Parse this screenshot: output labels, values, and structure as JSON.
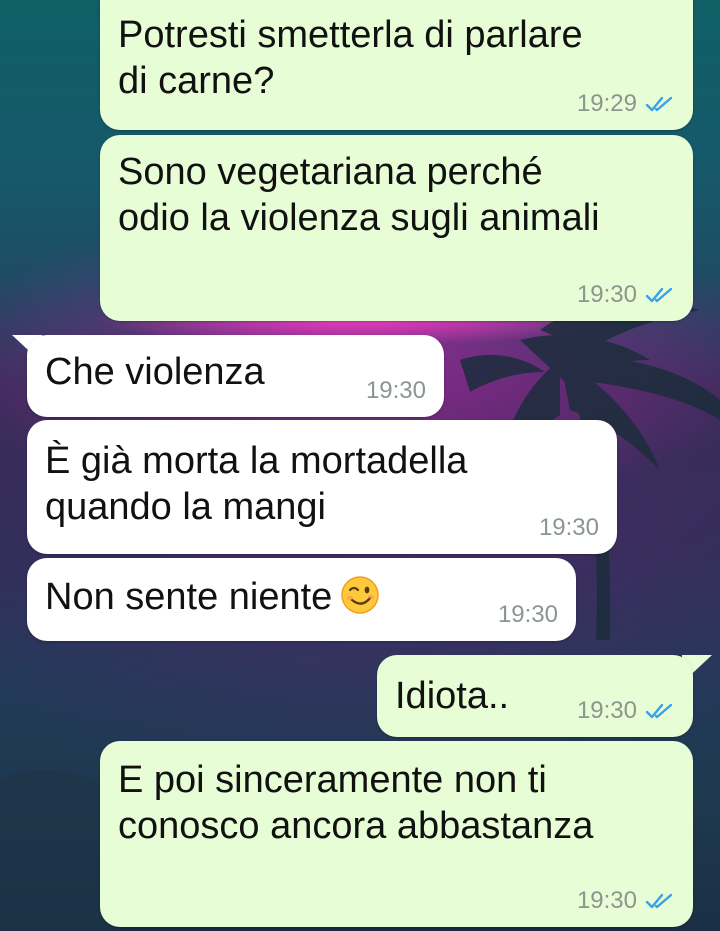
{
  "chat": {
    "messages": [
      {
        "id": "m1",
        "direction": "outgoing",
        "text": "Potresti smetterla di parlare\ndi carne?",
        "time": "19:29",
        "status": "read-double-check"
      },
      {
        "id": "m2",
        "direction": "outgoing",
        "text": "Sono vegetariana perché\nodio la violenza sugli animali",
        "time": "19:30",
        "status": "read-double-check"
      },
      {
        "id": "m3",
        "direction": "incoming",
        "text": "Che violenza",
        "time": "19:30"
      },
      {
        "id": "m4",
        "direction": "incoming",
        "text": "È già morta la mortadella\nquando la mangi",
        "time": "19:30"
      },
      {
        "id": "m5",
        "direction": "incoming",
        "text": "Non sente niente",
        "emoji": "winking-face-emoji",
        "time": "19:30"
      },
      {
        "id": "m6",
        "direction": "outgoing",
        "text": "Idiota..",
        "time": "19:30",
        "status": "read-double-check"
      },
      {
        "id": "m7",
        "direction": "outgoing",
        "text": "E poi sinceramente non ti\nconosco ancora abbastanza",
        "time": "19:30",
        "status": "read-double-check"
      }
    ]
  },
  "colors": {
    "outgoing_bubble": "#e7fdd5",
    "incoming_bubble": "#ffffff",
    "read_check": "#3aa0e8",
    "timestamp": "#8c9690"
  }
}
